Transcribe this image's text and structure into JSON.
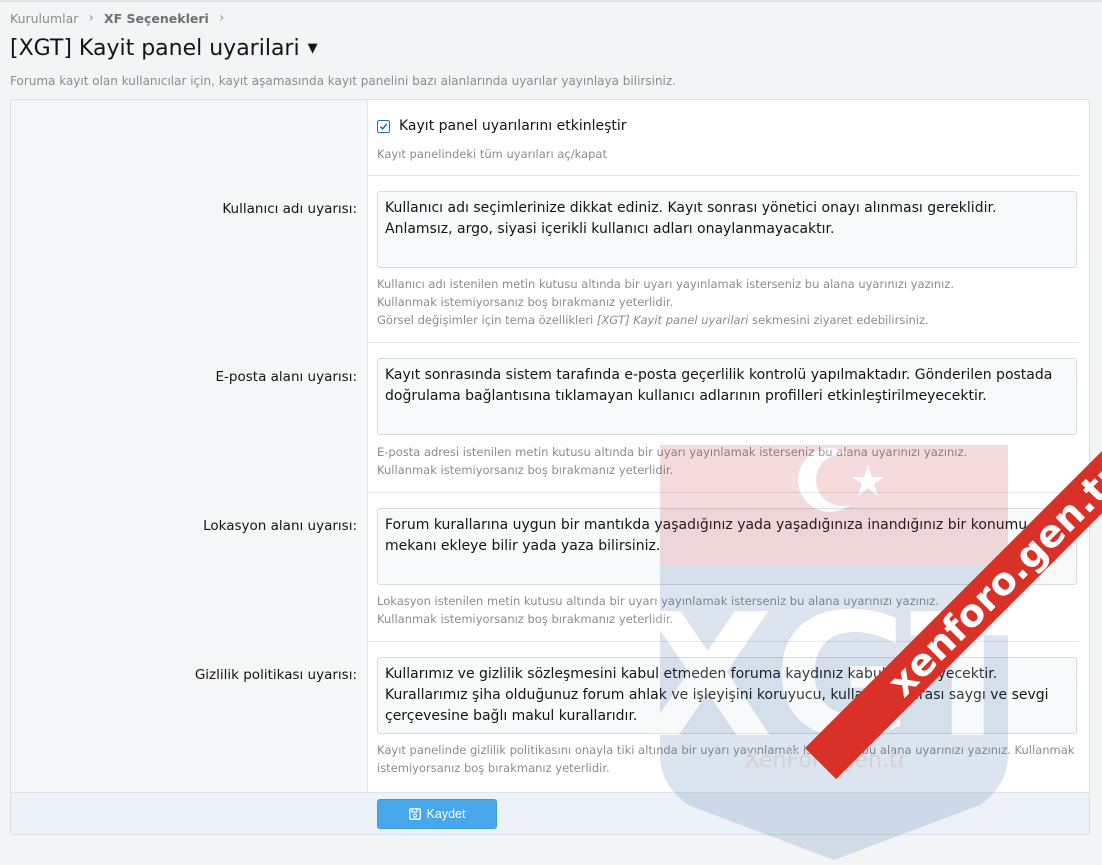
{
  "breadcrumb": {
    "items": [
      "Kurulumlar",
      "XF Seçenekleri"
    ]
  },
  "page": {
    "title": "[XGT] Kayit panel uyarilari",
    "description": "Foruma kayıt olan kullanıcılar için, kayıt aşamasında kayıt panelini bazı alanlarında uyarılar yayınlaya bilirsiniz."
  },
  "enable_option": {
    "label": "Kayıt panel uyarılarını etkinleştir",
    "checked": true,
    "hint": "Kayıt panelindeki tüm uyarıları aç/kapat"
  },
  "fields": [
    {
      "label": "Kullanıcı adı uyarısı:",
      "value": "Kullanıcı adı seçimlerinize dikkat ediniz. Kayıt sonrası yönetici onayı alınması gereklidir. Anlamsız, argo, siyasi içerikli kullanıcı adları onaylanmayacaktır.",
      "hint_lines": [
        "Kullanıcı adı istenilen metin kutusu altında bir uyarı yayınlamak isterseniz bu alana uyarınızı yazınız.",
        "Kullanmak istemiyorsanız boş bırakmanız yeterlidir."
      ],
      "hint_extra_prefix": "Görsel değişimler için tema özellikleri ",
      "hint_extra_em": "[XGT] Kayit panel uyarilari",
      "hint_extra_suffix": " sekmesini ziyaret edebilirsiniz."
    },
    {
      "label": "E-posta alanı uyarısı:",
      "value": "Kayıt sonrasında sistem tarafında e-posta geçerlilik kontrolü yapılmaktadır. Gönderilen postada doğrulama bağlantısına tıklamayan kullanıcı adlarının profilleri etkinleştirilmeyecektir.",
      "hint_lines": [
        "E-posta adresi istenilen metin kutusu altında bir uyarı yayınlamak isterseniz bu alana uyarınızı yazınız.",
        "Kullanmak istemiyorsanız boş bırakmanız yeterlidir."
      ]
    },
    {
      "label": "Lokasyon alanı uyarısı:",
      "value": "Forum kurallarına uygun bir mantıkda yaşadığınız yada yaşadığınıza inandığınız bir konumu, mekanı ekleye bilir yada yaza bilirsiniz.",
      "hint_lines": [
        "Lokasyon istenilen metin kutusu altında bir uyarı yayınlamak isterseniz bu alana uyarınızı yazınız.",
        "Kullanmak istemiyorsanız boş bırakmanız yeterlidir."
      ]
    },
    {
      "label": "Gizlilik politikası uyarısı:",
      "value": "Kullarımız ve gizlilik sözleşmesini kabul etmeden foruma kaydınız kabul edilmeyecektir. Kurallarımız şiha olduğunuz forum ahlak ve işleyişini koruyucu, kullanıcılar arası saygı ve sevgi çerçevesine bağlı makul kurallarıdır.",
      "hint_lines": [
        "Kayıt panelinde gizlilik politikasını onayla tiki altında bir uyarı yayınlamak isterseniz bu alana uyarınızı yazınız. Kullanmak istemiyorsanız boş bırakmanız yeterlidir."
      ]
    }
  ],
  "save_button": {
    "label": "Kaydet"
  },
  "watermark": {
    "logo_letters": "XGT",
    "caption": "XenForo.gen.tr",
    "ribbon": "xenforo.gen.tr"
  },
  "colors": {
    "accent": "#47a7eb",
    "ribbon": "#d93127",
    "checkbox": "#2577b1"
  }
}
